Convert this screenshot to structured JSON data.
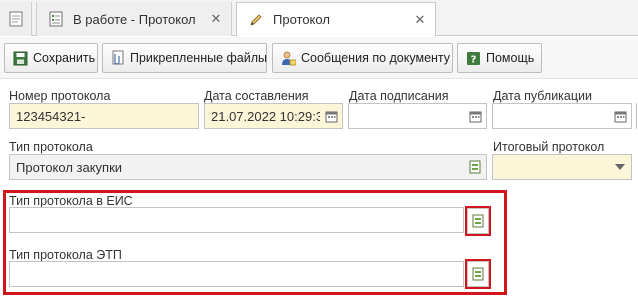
{
  "tabs": [
    {
      "label": "В работе - Протокол",
      "close": "✕",
      "icon": "document-list-icon",
      "active": false
    },
    {
      "label": "Протокол",
      "close": "✕",
      "icon": "pencil-icon",
      "active": true
    }
  ],
  "toolbar": {
    "save": "Сохранить",
    "attachments": "Прикрепленные файлы",
    "messages": "Сообщения по документу",
    "help": "Помощь"
  },
  "form": {
    "protocol_number": {
      "label": "Номер протокола",
      "value": "123454321-"
    },
    "date_created": {
      "label": "Дата составления",
      "value": "21.07.2022 10:29:3"
    },
    "date_signed": {
      "label": "Дата подписания",
      "value": ""
    },
    "date_published": {
      "label": "Дата публикации",
      "value": ""
    },
    "protocol_type": {
      "label": "Тип протокола",
      "value": "Протокол закупки"
    },
    "final_protocol": {
      "label": "Итоговый протокол",
      "value": ""
    },
    "eis_type": {
      "label": "Тип протокола в ЕИС",
      "value": ""
    },
    "etp_type": {
      "label": "Тип протокола ЭТП",
      "value": ""
    }
  },
  "colors": {
    "highlight": "#d0161c",
    "required_bg": "#fcf6d9",
    "readonly_bg": "#f2f2f2"
  }
}
